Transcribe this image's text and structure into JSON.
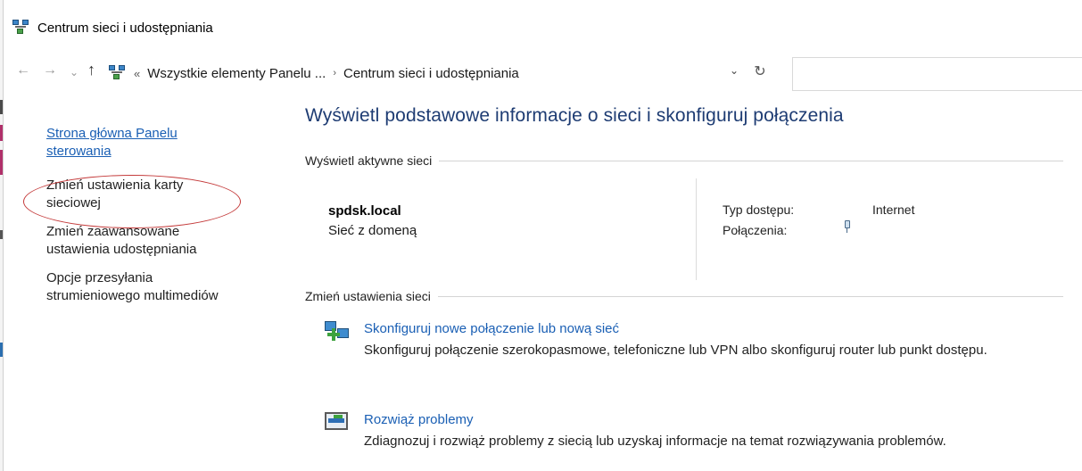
{
  "window": {
    "title": "Centrum sieci i udostępniania",
    "icon": "network-center-icon"
  },
  "navigation": {
    "back_icon": "←",
    "forward_icon": "→",
    "recent_icon": "⌄",
    "up_icon": "↑",
    "breadcrumb_prefix": "«",
    "breadcrumb": [
      "Wszystkie elementy Panelu ...",
      "Centrum sieci i udostępniania"
    ],
    "breadcrumb_separator": "›",
    "dropdown_icon": "⌄",
    "refresh_icon": "↻",
    "search_placeholder": ""
  },
  "sidebar": {
    "items": [
      {
        "lines": [
          "Strona główna Panelu",
          "sterowania"
        ],
        "kind": "home"
      },
      {
        "lines": [
          "Zmień ustawienia karty",
          "sieciowej"
        ],
        "kind": "link",
        "highlighted": true
      },
      {
        "lines": [
          "Zmień zaawansowane",
          "ustawienia udostępniania"
        ],
        "kind": "link"
      },
      {
        "lines": [
          "Opcje przesyłania",
          "strumieniowego multimediów"
        ],
        "kind": "link"
      }
    ],
    "highlight_color": "#c43a3a"
  },
  "main": {
    "title": "Wyświetl podstawowe informacje o sieci i skonfiguruj połączenia",
    "active_networks_label": "Wyświetl aktywne sieci",
    "network": {
      "name": "spdsk.local",
      "type": "Sieć z domeną",
      "access_type_label": "Typ dostępu:",
      "access_type_value": "Internet",
      "connections_label": "Połączenia:",
      "connection_icon": "ethernet-cable-icon"
    },
    "change_settings_label": "Zmień ustawienia sieci",
    "tasks": [
      {
        "icon": "new-connection-icon",
        "title": "Skonfiguruj nowe połączenie lub nową sieć",
        "description": "Skonfiguruj połączenie szerokopasmowe, telefoniczne lub VPN albo skonfiguruj router lub punkt dostępu."
      },
      {
        "icon": "troubleshoot-icon",
        "title": "Rozwiąż problemy",
        "description": "Zdiagnozuj i rozwiąż problemy z siecią lub uzyskaj informacje na temat rozwiązywania problemów."
      }
    ]
  },
  "colors": {
    "title_blue": "#1e3c73",
    "link_blue": "#1a5fb4"
  }
}
